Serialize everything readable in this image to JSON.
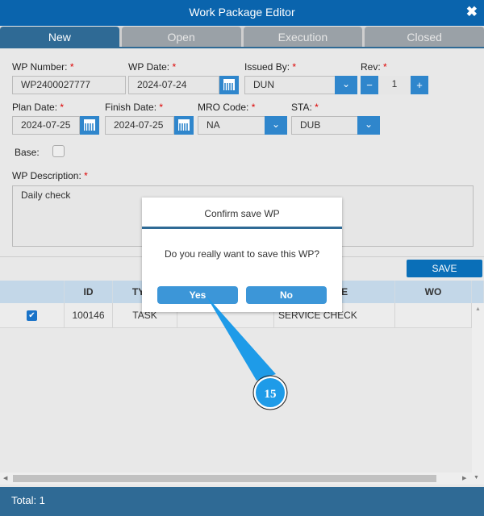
{
  "window": {
    "title": "Work Package Editor"
  },
  "tabs": [
    "New",
    "Open",
    "Execution",
    "Closed"
  ],
  "form": {
    "wp_number": {
      "label": "WP Number:",
      "value": "WP2400027777"
    },
    "wp_date": {
      "label": "WP Date:",
      "value": "2024-07-24"
    },
    "issued_by": {
      "label": "Issued By:",
      "value": "DUN"
    },
    "rev": {
      "label": "Rev:",
      "value": "1",
      "minus": "−",
      "plus": "+"
    },
    "plan_date": {
      "label": "Plan Date:",
      "value": "2024-07-25"
    },
    "finish_date": {
      "label": "Finish Date:",
      "value": "2024-07-25"
    },
    "mro_code": {
      "label": "MRO Code:",
      "value": "NA"
    },
    "sta": {
      "label": "STA:",
      "value": "DUB"
    },
    "base": {
      "label": "Base:",
      "checked": false
    },
    "description": {
      "label": "WP Description:",
      "value": "Daily check"
    },
    "required_mark": "*"
  },
  "save_label": "SAVE",
  "grid": {
    "columns": [
      "",
      "ID",
      "TYPE",
      "",
      "TITLE",
      "WO"
    ],
    "rows": [
      {
        "checked": true,
        "id": "100146",
        "type": "TASK",
        "col4": "",
        "title": "SERVICE CHECK",
        "wo": ""
      }
    ]
  },
  "footer": {
    "total": "Total: 1"
  },
  "dialog": {
    "title": "Confirm save WP",
    "message": "Do you really want to save this WP?",
    "yes": "Yes",
    "no": "No"
  },
  "annotation": {
    "step": "15",
    "color": "#1e9be8"
  }
}
